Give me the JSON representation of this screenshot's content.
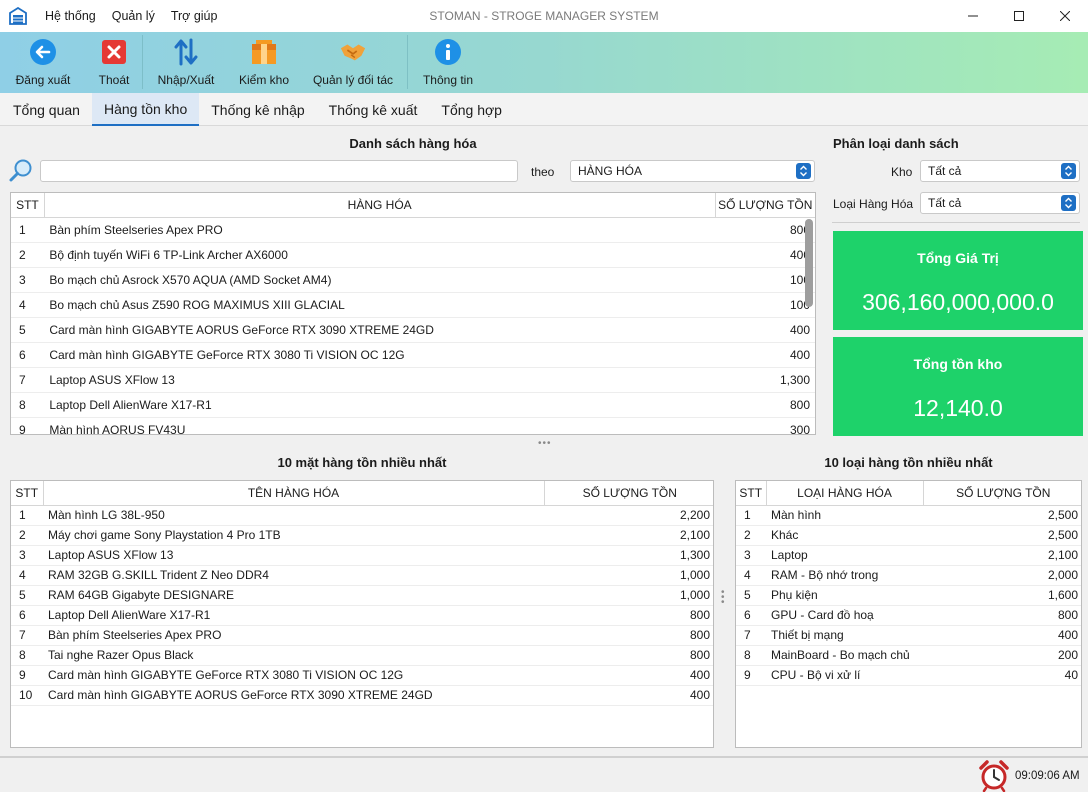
{
  "window": {
    "title": "STOMAN - STROGE MANAGER SYSTEM",
    "menu": [
      "Hệ thống",
      "Quản lý",
      "Trợ giúp"
    ]
  },
  "toolbar": {
    "items": [
      {
        "label": "Đăng xuất",
        "icon": "logout-arrow-icon"
      },
      {
        "label": "Thoát",
        "icon": "exit-x-icon"
      },
      {
        "label": "Nhập/Xuất",
        "icon": "import-export-arrows-icon"
      },
      {
        "label": "Kiểm kho",
        "icon": "inventory-box-icon"
      },
      {
        "label": "Quản lý đối tác",
        "icon": "handshake-icon"
      },
      {
        "label": "Thông tin",
        "icon": "info-icon"
      }
    ]
  },
  "tabs": [
    "Tổng quan",
    "Hàng tồn kho",
    "Thống kê nhập",
    "Thống kê xuất",
    "Tổng hợp"
  ],
  "active_tab": "Hàng tồn kho",
  "goods_list": {
    "title": "Danh sách hàng hóa",
    "search_value": "",
    "theo_label": "theo",
    "search_by": "HÀNG HÓA",
    "columns": [
      "STT",
      "HÀNG HÓA",
      "SỐ LƯỢNG TỒN"
    ],
    "rows": [
      [
        "1",
        "Bàn phím Steelseries Apex PRO",
        "800"
      ],
      [
        "2",
        "Bộ định tuyến WiFi 6 TP-Link Archer AX6000",
        "400"
      ],
      [
        "3",
        "Bo mạch chủ Asrock X570 AQUA (AMD Socket AM4)",
        "100"
      ],
      [
        "4",
        "Bo mạch chủ Asus Z590 ROG MAXIMUS XIII GLACIAL",
        "100"
      ],
      [
        "5",
        "Card màn hình GIGABYTE AORUS GeForce RTX 3090 XTREME 24GD",
        "400"
      ],
      [
        "6",
        "Card màn hình GIGABYTE GeForce RTX 3080 Ti VISION OC 12G",
        "400"
      ],
      [
        "7",
        "Laptop ASUS XFlow 13",
        "1,300"
      ],
      [
        "8",
        "Laptop Dell AlienWare X17-R1",
        "800"
      ],
      [
        "9",
        "Màn hình AORUS FV43U",
        "300"
      ]
    ]
  },
  "filters": {
    "title": "Phân loại danh sách",
    "kho_label": "Kho",
    "kho_value": "Tất cả",
    "loai_label": "Loại Hàng Hóa",
    "loai_value": "Tất cả"
  },
  "cards": {
    "total_value_title": "Tổng Giá Trị",
    "total_value": "306,160,000,000.0",
    "total_stock_title": "Tổng tồn kho",
    "total_stock": "12,140.0",
    "color": "#1ed26a"
  },
  "top_items": {
    "title": "10 mặt hàng tồn nhiều nhất",
    "columns": [
      "STT",
      "TÊN HÀNG HÓA",
      "SỐ LƯỢNG TỒN"
    ],
    "rows": [
      [
        "1",
        "Màn hình LG 38L-950",
        "2,200"
      ],
      [
        "2",
        "Máy chơi game Sony Playstation 4 Pro 1TB",
        "2,100"
      ],
      [
        "3",
        "Laptop ASUS XFlow 13",
        "1,300"
      ],
      [
        "4",
        "RAM 32GB G.SKILL Trident Z Neo DDR4",
        "1,000"
      ],
      [
        "5",
        "RAM 64GB Gigabyte DESIGNARE",
        "1,000"
      ],
      [
        "6",
        "Laptop Dell AlienWare X17-R1",
        "800"
      ],
      [
        "7",
        "Bàn phím Steelseries Apex PRO",
        "800"
      ],
      [
        "8",
        "Tai nghe Razer Opus Black",
        "800"
      ],
      [
        "9",
        "Card màn hình GIGABYTE GeForce RTX 3080 Ti VISION OC 12G",
        "400"
      ],
      [
        "10",
        "Card màn hình GIGABYTE AORUS GeForce RTX 3090 XTREME 24GD",
        "400"
      ]
    ]
  },
  "top_categories": {
    "title": "10 loại hàng tồn nhiều nhất",
    "columns": [
      "STT",
      "LOẠI HÀNG HÓA",
      "SỐ LƯỢNG TỒN"
    ],
    "rows": [
      [
        "1",
        "Màn hình",
        "2,500"
      ],
      [
        "2",
        "Khác",
        "2,500"
      ],
      [
        "3",
        "Laptop",
        "2,100"
      ],
      [
        "4",
        "RAM - Bộ nhớ trong",
        "2,000"
      ],
      [
        "5",
        "Phụ kiện",
        "1,600"
      ],
      [
        "6",
        "GPU - Card đồ hoạ",
        "800"
      ],
      [
        "7",
        "Thiết bị mạng",
        "400"
      ],
      [
        "8",
        "MainBoard - Bo mạch chủ",
        "200"
      ],
      [
        "9",
        "CPU - Bộ vi xử lí",
        "40"
      ]
    ]
  },
  "status": {
    "time": "09:09:06 AM"
  }
}
